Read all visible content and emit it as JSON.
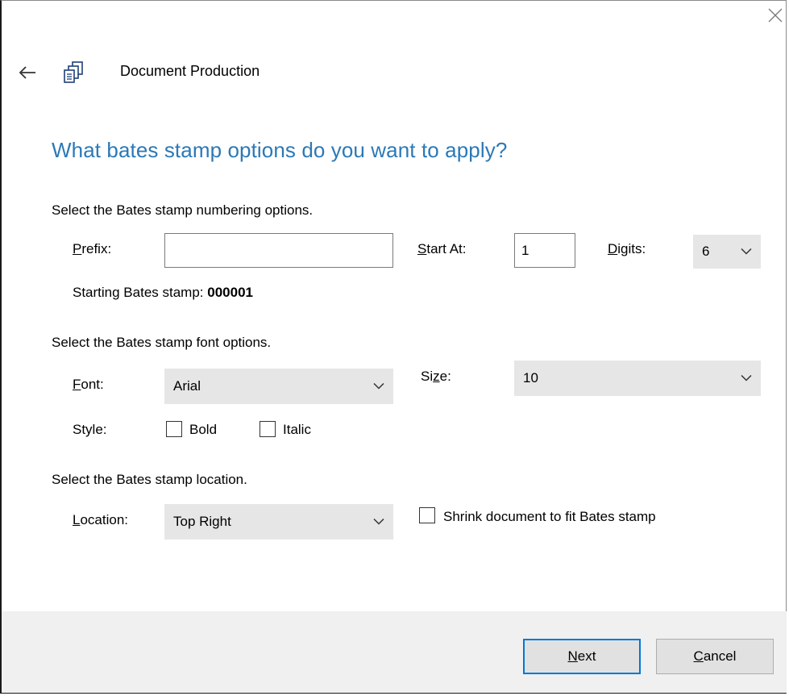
{
  "window": {
    "title": "Document Production",
    "close_icon": "close-icon",
    "back_icon": "back-arrow-icon",
    "app_icon": "document-production-icon"
  },
  "main": {
    "heading": "What bates stamp options do you want to apply?",
    "accent_color": "#2b79b7"
  },
  "numbering": {
    "section_label": "Select the Bates stamp numbering options.",
    "prefix_label_u": "P",
    "prefix_label_rest": "refix:",
    "prefix_value": "",
    "start_label_u": "S",
    "start_label_rest": "tart At:",
    "start_value": "1",
    "digits_label_u": "D",
    "digits_label_rest": "igits:",
    "digits_value": "6",
    "starting_label": "Starting Bates stamp:",
    "starting_value": "000001"
  },
  "font": {
    "section_label": "Select the Bates stamp font options.",
    "font_label_u": "F",
    "font_label_rest": "ont:",
    "font_value": "Arial",
    "size_label_pre": "Si",
    "size_label_u": "z",
    "size_label_rest": "e:",
    "size_value": "10",
    "style_label": "Style:",
    "bold_label": "Bold",
    "bold_checked": false,
    "italic_label": "Italic",
    "italic_checked": false
  },
  "location": {
    "section_label": "Select the Bates stamp location.",
    "location_label_u": "L",
    "location_label_rest": "ocation:",
    "location_value": "Top Right",
    "shrink_label": "Shrink document to fit Bates stamp",
    "shrink_checked": false
  },
  "footer": {
    "next_label_u": "N",
    "next_label_rest": "ext",
    "cancel_label_u": "C",
    "cancel_label_rest": "ancel",
    "default_button_color": "#0078d7"
  }
}
